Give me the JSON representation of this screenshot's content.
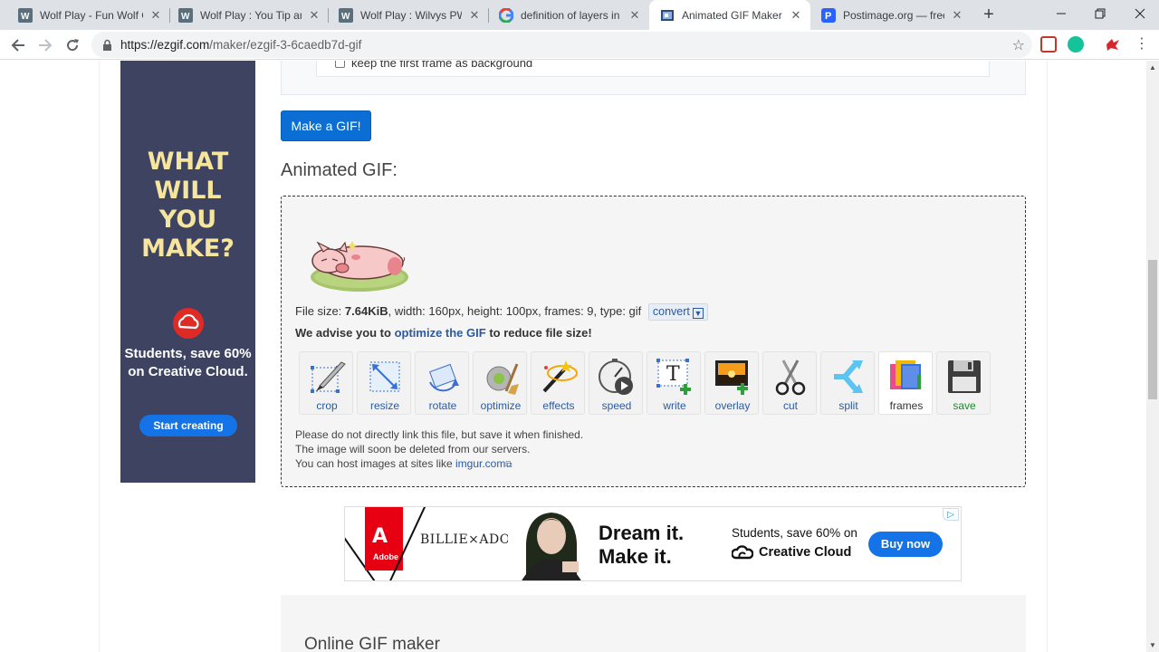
{
  "browser": {
    "tabs": [
      {
        "title": "Wolf Play - Fun Wolf Ga",
        "favicon": "wp-icon",
        "active": false
      },
      {
        "title": "Wolf Play : You Tip and",
        "favicon": "wp-icon",
        "active": false
      },
      {
        "title": "Wolf Play : Wilvys PWY\\",
        "favicon": "wp-icon",
        "active": false
      },
      {
        "title": "definition of layers in d",
        "favicon": "google-icon",
        "active": false
      },
      {
        "title": "Animated GIF Maker",
        "favicon": "ezgif-icon",
        "active": true
      },
      {
        "title": "Postimage.org — free im",
        "favicon": "postimage-icon",
        "active": false
      }
    ],
    "close_glyph": "✕",
    "new_tab_glyph": "+",
    "url_host": "https://ezgif.com",
    "url_path": "/maker/ezgif-3-6caedb7d-gif"
  },
  "side_ad": {
    "headline": "WHAT WILL YOU MAKE?",
    "sub": "Students, save 60% on Creative Cloud.",
    "cta": "Start creating"
  },
  "options": {
    "keep_first_frame_label": "keep the first frame as background",
    "keep_first_frame_checked": false
  },
  "make_button": "Make a GIF!",
  "section_title": "Animated GIF:",
  "file_info": {
    "prefix": "File size: ",
    "size": "7.64KiB",
    "rest": ", width: 160px, height: 100px, frames: 9, type: gif",
    "convert": "convert"
  },
  "advise": {
    "before": "We advise you to ",
    "link": "optimize the GIF",
    "after": " to reduce file size!"
  },
  "tools": [
    {
      "label": "crop",
      "icon": "crop-icon"
    },
    {
      "label": "resize",
      "icon": "resize-icon"
    },
    {
      "label": "rotate",
      "icon": "rotate-icon"
    },
    {
      "label": "optimize",
      "icon": "optimize-icon"
    },
    {
      "label": "effects",
      "icon": "effects-icon"
    },
    {
      "label": "speed",
      "icon": "speed-icon"
    },
    {
      "label": "write",
      "icon": "write-icon"
    },
    {
      "label": "overlay",
      "icon": "overlay-icon"
    },
    {
      "label": "cut",
      "icon": "scissors-icon"
    },
    {
      "label": "split",
      "icon": "split-icon"
    },
    {
      "label": "frames",
      "icon": "frames-icon"
    },
    {
      "label": "save",
      "icon": "save-icon"
    }
  ],
  "notes": {
    "line1": "Please do not directly link this file, but save it when finished.",
    "line2": "The image will soon be deleted from our servers.",
    "line3_prefix": "You can host images at sites like ",
    "line3_link": "imgur.com"
  },
  "banner_ad": {
    "brand": "Adobe",
    "artist": "BILLIE×ADOBE",
    "dream1": "Dream it.",
    "dream2": "Make it.",
    "students": "Students, save 60% on",
    "cc": "Creative Cloud",
    "buy": "Buy now"
  },
  "bottom_title": "Online GIF maker",
  "colors": {
    "accent": "#0b6ed4",
    "link": "#2a5aa3",
    "side_ad_bg": "#3e4362",
    "side_ad_headline": "#f6e59e",
    "adobe_red": "#e60012",
    "cta_blue": "#1473e6"
  }
}
